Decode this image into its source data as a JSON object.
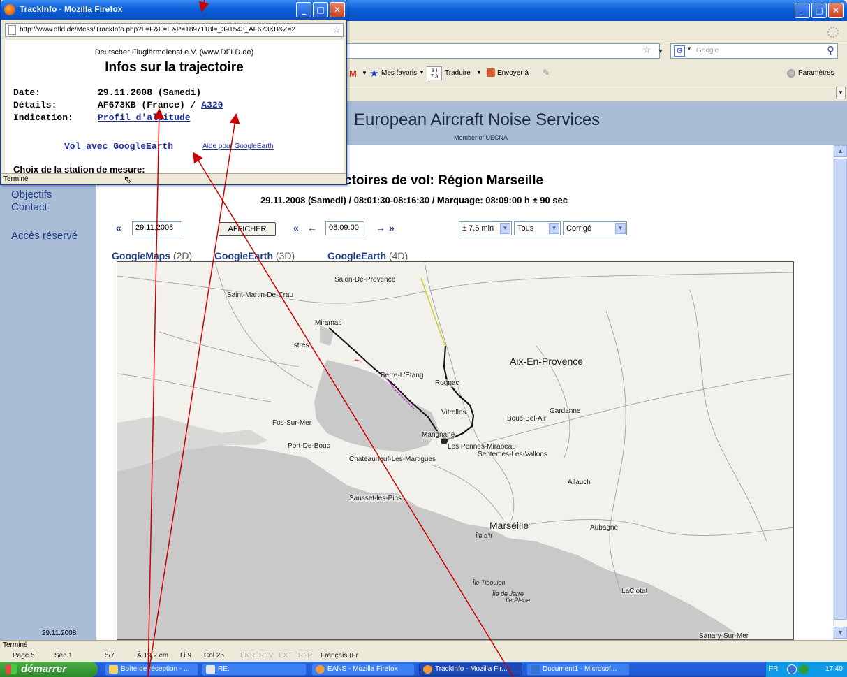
{
  "popup": {
    "title": "TrackInfo - Mozilla Firefox",
    "url": "http://www.dfld.de/Mess/TrackInfo.php?L=F&E=E&P=1897118l=_391543_AF673KB&Z=2",
    "org": "Deutscher Fluglärmdienst e.V. (www.DFLD.de)",
    "heading": "Infos sur la trajectoire",
    "rows": [
      {
        "label": "Date:",
        "value": "29.11.2008 (Samedi)"
      },
      {
        "label": "Détails:",
        "value": "AF673KB (France) / ",
        "link": "A320"
      },
      {
        "label": "Indication:",
        "link": "Profil d'altitude"
      }
    ],
    "vol_link": "Vol avec GoogleEarth",
    "aide_link": "Aide pour GoogleEarth",
    "choix_label": "Choix de la station de mesure:",
    "status": "Terminé"
  },
  "browser": {
    "search_placeholder": "Google",
    "toolbar": {
      "mes_favoris": "Mes favoris",
      "traduire": "Traduire",
      "envoyer": "Envoyer à",
      "parametres": "Paramètres"
    },
    "status": "Terminé"
  },
  "site": {
    "title": "European Aircraft Noise Services",
    "subtitle": "Member of UECNA",
    "sidebar": {
      "objectifs": "Objectifs",
      "contact": "Contact",
      "acces": "Accès réservé",
      "date": "29.11.2008"
    },
    "heading": "ctoires de vol: Région Marseille",
    "subheading": "29.11.2008 (Samedi) / 08:01:30-08:16:30 / Marquage: 08:09:00 h ± 90 sec",
    "controls": {
      "date": "29.11.2008",
      "afficher": "AFFICHER",
      "time": "08:09:00",
      "range": "± 7,5 min",
      "filter": "Tous",
      "mode": "Corrigé",
      "prev_fast": "«",
      "prev_fast2": "«",
      "prev": "←",
      "next": "→",
      "next_fast": "»"
    },
    "map_links": [
      {
        "name": "GoogleMaps",
        "dim": " (2D)"
      },
      {
        "name": "GoogleEarth",
        "dim": " (3D)"
      },
      {
        "name": "GoogleEarth",
        "dim": " (4D)"
      }
    ],
    "map_places": {
      "salon": "Salon-De-Provence",
      "saint_martin": "Saint-Martin-De-Crau",
      "miramas": "Miramas",
      "istres": "Istres",
      "berre": "Berre-L'Etang",
      "rognac": "Rognac",
      "aix": "Aix-En-Provence",
      "gardanne": "Gardanne",
      "bouc_bel_air": "Bouc-Bel-Air",
      "vitrolles": "Vitrolles",
      "fos": "Fos-Sur-Mer",
      "port_de_bouc": "Port-De-Bouc",
      "marignane": "Marignane",
      "pennes": "Les Pennes-Mirabeau",
      "septemes": "Septemes-Les-Vallons",
      "chateauneuf": "Chateauneuf-Les-Martigues",
      "allauch": "Allauch",
      "sausset": "Sausset-les-Pins",
      "marseille": "Marseille",
      "ile_if": "Île d'If",
      "aubagne": "Aubagne",
      "tiboulen": "Île Tiboulen",
      "jarre": "Île de Jarre",
      "plane": "Île Plane",
      "laciotat": "LaCiotat",
      "sanary": "Sanary-Sur-Mer"
    }
  },
  "word_status": {
    "page": "Page 5",
    "sec": "Sec 1",
    "pages": "5/7",
    "position": "À 19,2 cm",
    "line": "Li 9",
    "col": "Col 25",
    "enr": "ENR",
    "rev": "REV",
    "ext": "EXT",
    "rfp": "RFP",
    "lang": "Français (Fr"
  },
  "taskbar": {
    "start": "démarrer",
    "tasks": [
      {
        "label": "Boîte de réception - ...",
        "color": "#f4d35e"
      },
      {
        "label": "RE:",
        "color": "#e7e7e7"
      },
      {
        "label": "EANS - Mozilla Firefox",
        "color": "#f29b38"
      },
      {
        "label": "TrackInfo - Mozilla Fir...",
        "color": "#f29b38"
      },
      {
        "label": "Document1 - Microsof...",
        "color": "#3a6fd0"
      }
    ],
    "lang": "FR",
    "clock": "17:40"
  },
  "colors": {
    "title_blue": "#0a5ed8",
    "header_blue": "#a9bdd7",
    "link_blue": "#1f3d86",
    "annotation_red": "#cc0000",
    "map_water": "#c8c8c8",
    "map_land": "#f2f1ec"
  }
}
